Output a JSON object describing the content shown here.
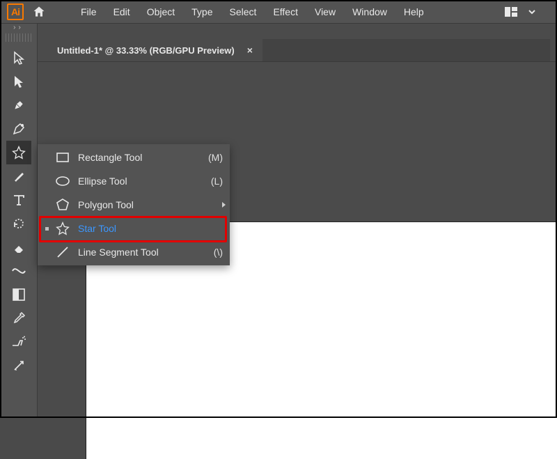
{
  "app": {
    "logo_text": "Ai"
  },
  "menubar": {
    "items": [
      "File",
      "Edit",
      "Object",
      "Type",
      "Select",
      "Effect",
      "View",
      "Window",
      "Help"
    ]
  },
  "document_tab": {
    "title": "Untitled-1* @ 33.33% (RGB/GPU Preview)",
    "close_glyph": "×"
  },
  "rail": {
    "expand_glyph": "››"
  },
  "flyout": {
    "items": [
      {
        "icon": "rectangle-icon",
        "label": "Rectangle Tool",
        "shortcut": "(M)",
        "active": false,
        "has_submenu": false
      },
      {
        "icon": "ellipse-icon",
        "label": "Ellipse Tool",
        "shortcut": "(L)",
        "active": false,
        "has_submenu": false
      },
      {
        "icon": "polygon-icon",
        "label": "Polygon Tool",
        "shortcut": "",
        "active": false,
        "has_submenu": true
      },
      {
        "icon": "star-icon",
        "label": "Star Tool",
        "shortcut": "",
        "active": true,
        "has_submenu": false
      },
      {
        "icon": "line-icon",
        "label": "Line Segment Tool",
        "shortcut": "(\\)",
        "active": false,
        "has_submenu": false
      }
    ]
  }
}
